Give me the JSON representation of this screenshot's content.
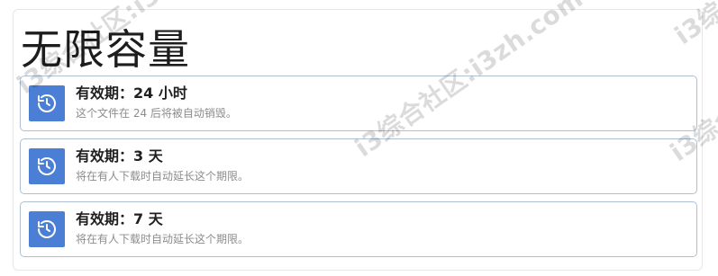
{
  "page": {
    "title": "无限容量"
  },
  "cards": [
    {
      "title": "有效期：24 小时",
      "description": "这个文件在 24 后将被自动销毁。",
      "icon": "history-icon"
    },
    {
      "title": "有效期：3 天",
      "description": "将在有人下载时自动延长这个期限。",
      "icon": "history-icon"
    },
    {
      "title": "有效期：7 天",
      "description": "将在有人下载时自动延长这个期限。",
      "icon": "history-icon"
    }
  ],
  "watermark": {
    "text_a": "i3综合社区:i3zh.com",
    "text_b": "i3综合社区:i3zh.com",
    "text_c": "i3综合社区:i3zh.com",
    "text_d": "i3综合社区:i3zh.com"
  },
  "colors": {
    "accent": "#4b7fd6",
    "card_border": "#aebfd4",
    "muted_text": "#8c8c8c"
  }
}
